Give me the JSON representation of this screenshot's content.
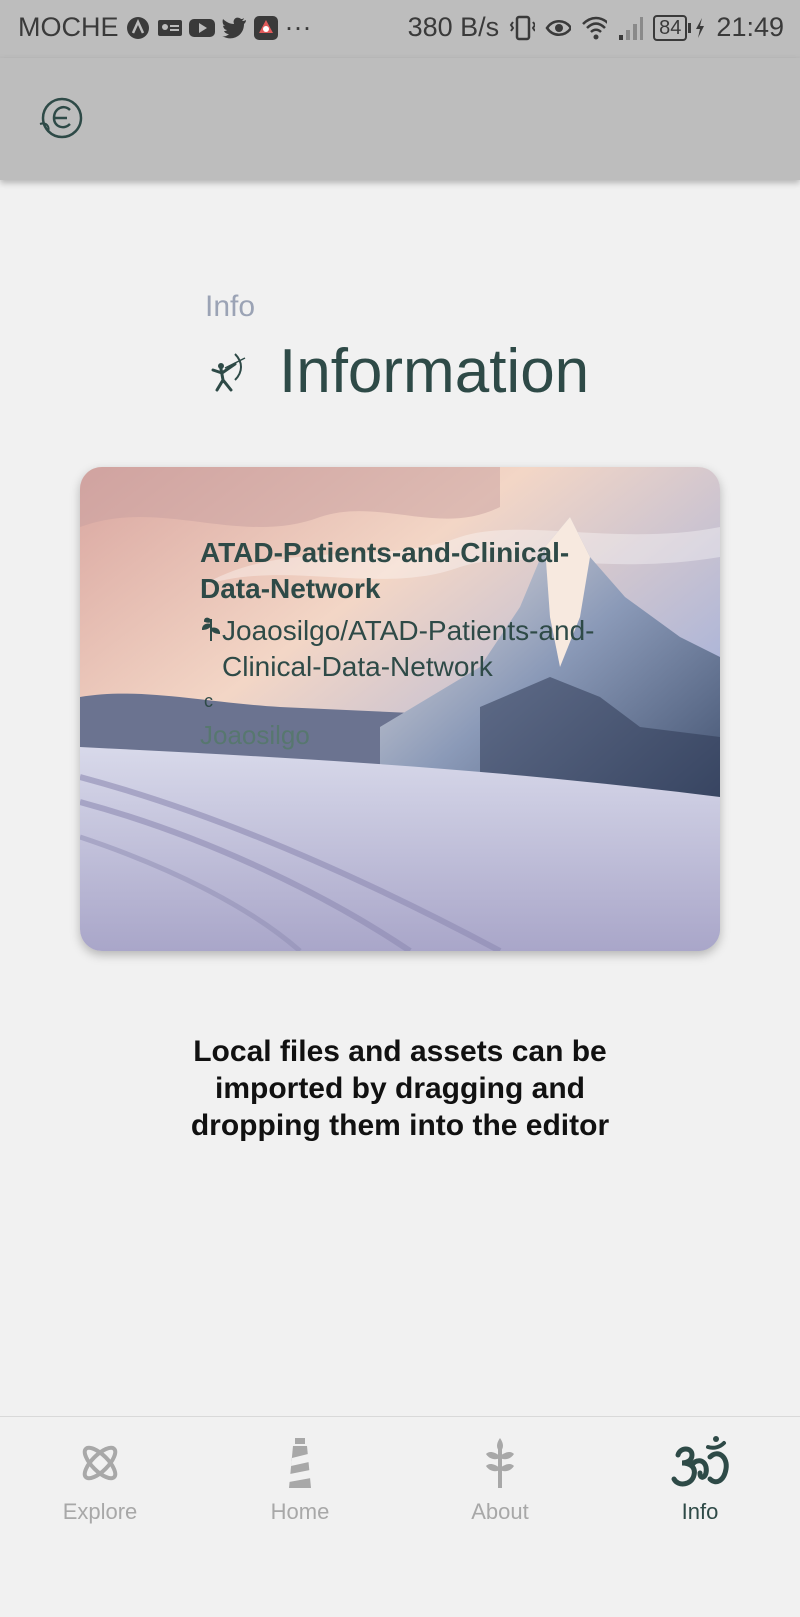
{
  "status_bar": {
    "carrier": "MOCHE",
    "more": "···",
    "speed": "380 B/s",
    "battery": "84",
    "time": "21:49"
  },
  "page": {
    "subtitle": "Info",
    "title": "Information"
  },
  "card": {
    "title": "ATAD-Patients-and-Clinical-Data-Network",
    "repo": "Joaosilgo/ATAD-Patients-and-Clinical-Data-Network",
    "small": "c",
    "user": "Joaosilgo"
  },
  "note": "Local files and assets can be imported by dragging and dropping them into the editor",
  "nav": {
    "tabs": [
      {
        "label": "Explore",
        "icon": "atom-icon"
      },
      {
        "label": "Home",
        "icon": "lighthouse-icon"
      },
      {
        "label": "About",
        "icon": "wheat-icon"
      },
      {
        "label": "Info",
        "icon": "om-icon"
      }
    ],
    "active": "Info"
  },
  "colors": {
    "accent": "#2e4a47",
    "inactive": "#a8a8a8",
    "bar": "#bdbdbd"
  }
}
